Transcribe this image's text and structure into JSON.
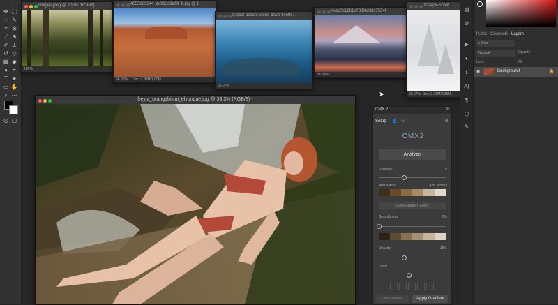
{
  "docs": [
    {
      "title": "images.jpeg @ 200% (RGB/8)",
      "zoom": "200%",
      "doc_info": ""
    },
    {
      "title": "4555863544_ac913c3e99_b.jpg @ 1",
      "zoom": "66.67%",
      "doc_info": "Doc: 2.00M/2.00M"
    },
    {
      "title": "typical-ocean-scene-dave-fleeth...",
      "zoom": "66.67%",
      "doc_info": ""
    },
    {
      "title": "4acc7c1861c730f4d33c7534f",
      "zoom": "33.33%",
      "doc_info": ""
    },
    {
      "title": "1024px-Snow",
      "zoom": "66.67%",
      "doc_info": "Doc: 2.25M/2.25M"
    }
  ],
  "main_doc": {
    "title": "freyja_orangebikini_elyunque.jpg @ 33.3% (RGB/8) *"
  },
  "right_panel": {
    "tabs": [
      "Paths",
      "Channels",
      "Layers"
    ],
    "active_tab": "Layers",
    "kind_placeholder": "Kind",
    "blend_mode": "Normal",
    "opacity_label": "Opacity:",
    "lock_label": "Lock:",
    "fill_label": "Fill:",
    "layer_name": "Background"
  },
  "cmx": {
    "title": "CMX 2",
    "tabs": [
      "Setup"
    ],
    "logo_text": "CMX2",
    "analyze_label": "Analyze",
    "samples_label": "Samples",
    "samples_value": "5",
    "add_blacks_label": "Add Blacks",
    "add_whites_label": "Add Whites",
    "open_editor_label": "Open Gradient Editor",
    "smoothness_label": "Smoothness",
    "smoothness_value": "0%",
    "opacity_label": "Opacity",
    "opacity_value": "35%",
    "used_label": "Used",
    "set_gradient_label": "Set Gradient",
    "apply_gradient_label": "Apply Gradient",
    "opacity_fraction": 0.38,
    "samples_fraction": 0.37,
    "smoothness_fraction": 0.0,
    "used_fraction": 0.45
  },
  "palette1": [
    "#3d3019",
    "#6a4a27",
    "#8c6a43",
    "#a88a63",
    "#c8b59e",
    "#e2d9cc"
  ],
  "palette2": [
    "#2a2418",
    "#5e4a33",
    "#8a7052",
    "#a58f73",
    "#c6b49d",
    "#ddd3c4"
  ],
  "colors": {
    "fg": "#000000",
    "bg": "#ffffff",
    "accent": "#b34a39"
  }
}
